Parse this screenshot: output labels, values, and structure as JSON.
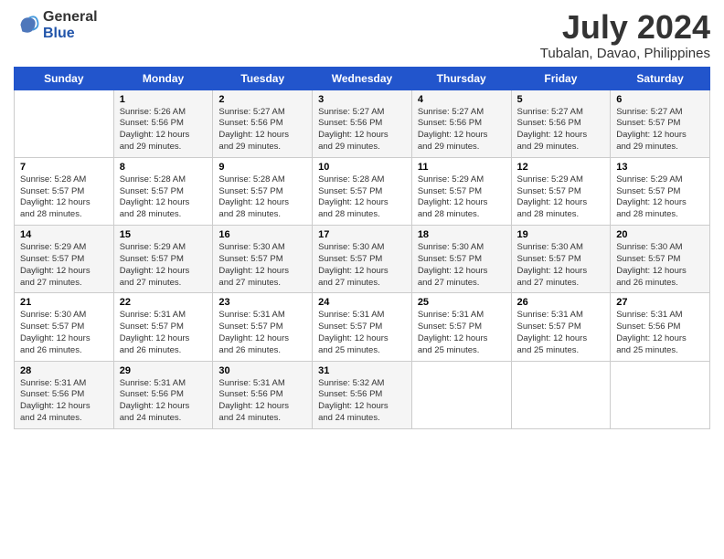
{
  "logo": {
    "line1": "General",
    "line2": "Blue"
  },
  "title": "July 2024",
  "subtitle": "Tubalan, Davao, Philippines",
  "days_of_week": [
    "Sunday",
    "Monday",
    "Tuesday",
    "Wednesday",
    "Thursday",
    "Friday",
    "Saturday"
  ],
  "weeks": [
    [
      {
        "day": "",
        "info": ""
      },
      {
        "day": "1",
        "info": "Sunrise: 5:26 AM\nSunset: 5:56 PM\nDaylight: 12 hours\nand 29 minutes."
      },
      {
        "day": "2",
        "info": "Sunrise: 5:27 AM\nSunset: 5:56 PM\nDaylight: 12 hours\nand 29 minutes."
      },
      {
        "day": "3",
        "info": "Sunrise: 5:27 AM\nSunset: 5:56 PM\nDaylight: 12 hours\nand 29 minutes."
      },
      {
        "day": "4",
        "info": "Sunrise: 5:27 AM\nSunset: 5:56 PM\nDaylight: 12 hours\nand 29 minutes."
      },
      {
        "day": "5",
        "info": "Sunrise: 5:27 AM\nSunset: 5:56 PM\nDaylight: 12 hours\nand 29 minutes."
      },
      {
        "day": "6",
        "info": "Sunrise: 5:27 AM\nSunset: 5:57 PM\nDaylight: 12 hours\nand 29 minutes."
      }
    ],
    [
      {
        "day": "7",
        "info": "Sunrise: 5:28 AM\nSunset: 5:57 PM\nDaylight: 12 hours\nand 28 minutes."
      },
      {
        "day": "8",
        "info": "Sunrise: 5:28 AM\nSunset: 5:57 PM\nDaylight: 12 hours\nand 28 minutes."
      },
      {
        "day": "9",
        "info": "Sunrise: 5:28 AM\nSunset: 5:57 PM\nDaylight: 12 hours\nand 28 minutes."
      },
      {
        "day": "10",
        "info": "Sunrise: 5:28 AM\nSunset: 5:57 PM\nDaylight: 12 hours\nand 28 minutes."
      },
      {
        "day": "11",
        "info": "Sunrise: 5:29 AM\nSunset: 5:57 PM\nDaylight: 12 hours\nand 28 minutes."
      },
      {
        "day": "12",
        "info": "Sunrise: 5:29 AM\nSunset: 5:57 PM\nDaylight: 12 hours\nand 28 minutes."
      },
      {
        "day": "13",
        "info": "Sunrise: 5:29 AM\nSunset: 5:57 PM\nDaylight: 12 hours\nand 28 minutes."
      }
    ],
    [
      {
        "day": "14",
        "info": "Sunrise: 5:29 AM\nSunset: 5:57 PM\nDaylight: 12 hours\nand 27 minutes."
      },
      {
        "day": "15",
        "info": "Sunrise: 5:29 AM\nSunset: 5:57 PM\nDaylight: 12 hours\nand 27 minutes."
      },
      {
        "day": "16",
        "info": "Sunrise: 5:30 AM\nSunset: 5:57 PM\nDaylight: 12 hours\nand 27 minutes."
      },
      {
        "day": "17",
        "info": "Sunrise: 5:30 AM\nSunset: 5:57 PM\nDaylight: 12 hours\nand 27 minutes."
      },
      {
        "day": "18",
        "info": "Sunrise: 5:30 AM\nSunset: 5:57 PM\nDaylight: 12 hours\nand 27 minutes."
      },
      {
        "day": "19",
        "info": "Sunrise: 5:30 AM\nSunset: 5:57 PM\nDaylight: 12 hours\nand 27 minutes."
      },
      {
        "day": "20",
        "info": "Sunrise: 5:30 AM\nSunset: 5:57 PM\nDaylight: 12 hours\nand 26 minutes."
      }
    ],
    [
      {
        "day": "21",
        "info": "Sunrise: 5:30 AM\nSunset: 5:57 PM\nDaylight: 12 hours\nand 26 minutes."
      },
      {
        "day": "22",
        "info": "Sunrise: 5:31 AM\nSunset: 5:57 PM\nDaylight: 12 hours\nand 26 minutes."
      },
      {
        "day": "23",
        "info": "Sunrise: 5:31 AM\nSunset: 5:57 PM\nDaylight: 12 hours\nand 26 minutes."
      },
      {
        "day": "24",
        "info": "Sunrise: 5:31 AM\nSunset: 5:57 PM\nDaylight: 12 hours\nand 25 minutes."
      },
      {
        "day": "25",
        "info": "Sunrise: 5:31 AM\nSunset: 5:57 PM\nDaylight: 12 hours\nand 25 minutes."
      },
      {
        "day": "26",
        "info": "Sunrise: 5:31 AM\nSunset: 5:57 PM\nDaylight: 12 hours\nand 25 minutes."
      },
      {
        "day": "27",
        "info": "Sunrise: 5:31 AM\nSunset: 5:56 PM\nDaylight: 12 hours\nand 25 minutes."
      }
    ],
    [
      {
        "day": "28",
        "info": "Sunrise: 5:31 AM\nSunset: 5:56 PM\nDaylight: 12 hours\nand 24 minutes."
      },
      {
        "day": "29",
        "info": "Sunrise: 5:31 AM\nSunset: 5:56 PM\nDaylight: 12 hours\nand 24 minutes."
      },
      {
        "day": "30",
        "info": "Sunrise: 5:31 AM\nSunset: 5:56 PM\nDaylight: 12 hours\nand 24 minutes."
      },
      {
        "day": "31",
        "info": "Sunrise: 5:32 AM\nSunset: 5:56 PM\nDaylight: 12 hours\nand 24 minutes."
      },
      {
        "day": "",
        "info": ""
      },
      {
        "day": "",
        "info": ""
      },
      {
        "day": "",
        "info": ""
      }
    ]
  ]
}
